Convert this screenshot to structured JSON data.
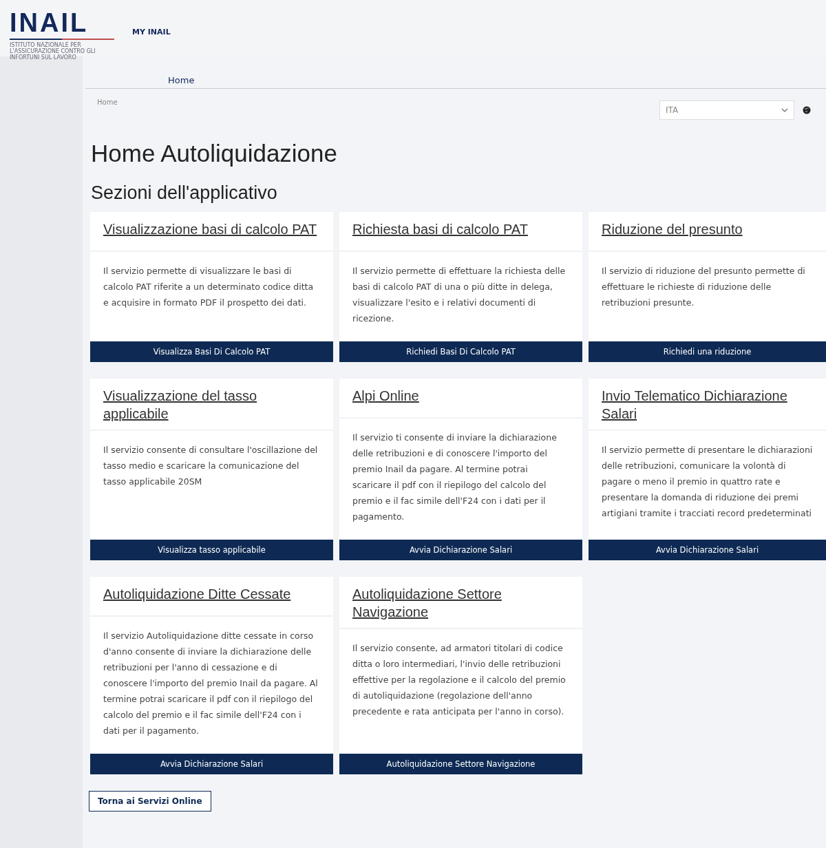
{
  "header": {
    "logo": "INAIL",
    "logo_tagline": "ISTITUTO NAZIONALE PER L'ASSICURAZIONE CONTRO GLI INFORTUNI SUL LAVORO",
    "app_name": "MY INAIL"
  },
  "nav": [
    {
      "label": "Home",
      "selected": true
    }
  ],
  "breadcrumb": [
    "Home"
  ],
  "language": {
    "value": "ITA"
  },
  "title": "Home Autoliquidazione",
  "subtitle": "Sezioni dell'applicativo",
  "cards": [
    {
      "title": "Visualizzazione basi di calcolo PAT",
      "text": "Il servizio permette di visualizzare le basi di calcolo PAT riferite a un determinato codice ditta e acquisire in formato PDF il prospetto dei dati.",
      "button": "Visualizza Basi Di Calcolo PAT"
    },
    {
      "title": "Richiesta basi di calcolo PAT",
      "text": "Il servizio permette di effettuare la richiesta delle basi di calcolo PAT di una o più ditte in delega, visualizzare l'esito e i relativi documenti di ricezione.",
      "button": "Richiedi Basi Di Calcolo PAT"
    },
    {
      "title": "Riduzione del presunto",
      "text": "Il servizio di riduzione del presunto permette di effettuare le richieste di riduzione delle retribuzioni presunte.",
      "button": "Richiedi una riduzione"
    },
    {
      "title": "Visualizzazione del tasso applicabile",
      "text": "Il servizio consente di consultare l'oscillazione del tasso medio e scaricare la comunicazione del tasso applicabile 20SM",
      "button": "Visualizza tasso applicabile"
    },
    {
      "title": "Alpi Online",
      "text": "Il servizio ti consente di inviare la dichiarazione delle retribuzioni e di conoscere l'importo del premio Inail da pagare. Al termine potrai scaricare il pdf con il riepilogo del calcolo del premio e il fac simile dell'F24 con i dati per il pagamento.",
      "button": "Avvia Dichiarazione Salari"
    },
    {
      "title": "Invio Telematico Dichiarazione Salari",
      "text": "Il servizio permette di presentare le dichiarazioni delle retribuzioni, comunicare la volontà di pagare o meno il premio in quattro rate e presentare la domanda di riduzione dei premi artigiani tramite i tracciati record predeterminati",
      "button": "Avvia Dichiarazione Salari"
    },
    {
      "title": "Autoliquidazione Ditte Cessate",
      "text": "Il servizio Autoliquidazione ditte cessate in corso d'anno consente di inviare la dichiarazione delle retribuzioni per l'anno di cessazione e di conoscere l'importo del premio Inail da pagare. Al termine potrai scaricare il pdf con il riepilogo del calcolo del premio e il fac simile dell'F24 con i dati per il pagamento.",
      "button": "Avvia Dichiarazione Salari"
    },
    {
      "title": "Autoliquidazione Settore Navigazione",
      "text": "Il servizio consente, ad armatori titolari di codice ditta o loro intermediari, l'invio delle retribuzioni effettive per la regolazione e il calcolo del premio di autoliquidazione (regolazione dell'anno precedente e rata anticipata per l'anno in corso).",
      "button": "Autoliquidazione Settore Navigazione"
    }
  ],
  "back_button": "Torna ai Servizi Online"
}
